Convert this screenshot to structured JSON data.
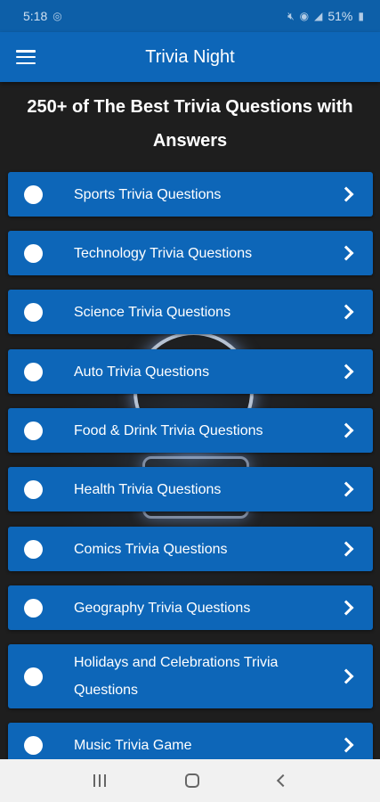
{
  "status_bar": {
    "time": "5:18",
    "battery": "51%"
  },
  "app_bar": {
    "title": "Trivia Night"
  },
  "headline": "250+ of The Best Trivia Questions with Answers",
  "categories": [
    {
      "label": "Sports Trivia Questions"
    },
    {
      "label": "Technology Trivia Questions"
    },
    {
      "label": "Science Trivia Questions"
    },
    {
      "label": "Auto Trivia Questions"
    },
    {
      "label": "Food & Drink Trivia Questions"
    },
    {
      "label": "Health Trivia Questions"
    },
    {
      "label": "Comics Trivia Questions"
    },
    {
      "label": "Geography Trivia Questions"
    },
    {
      "label": "Holidays and Celebrations Trivia Questions"
    },
    {
      "label": "Music Trivia Game"
    }
  ],
  "colors": {
    "primary": "#0d66b8",
    "status_bar": "#0d5fa8",
    "background": "#1e1e1e",
    "nav_bar": "#f1f1f1"
  }
}
